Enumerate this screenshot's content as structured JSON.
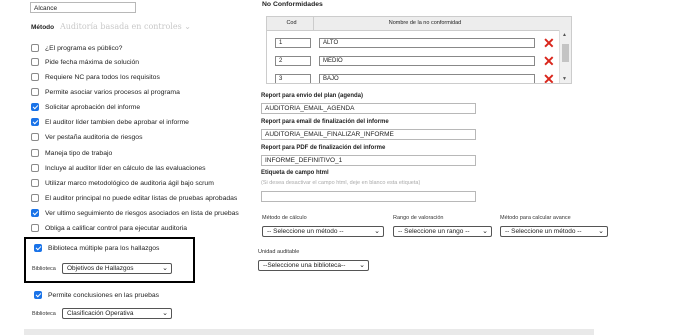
{
  "left": {
    "alcance_value": "Alcance",
    "metodo_label": "Método",
    "metodo_value": "Auditoría basada en controles",
    "checkboxes": [
      {
        "label": "¿El programa es público?",
        "checked": false
      },
      {
        "label": "Pide fecha máxima de solución",
        "checked": false
      },
      {
        "label": "Requiere NC para todos los requisitos",
        "checked": false
      },
      {
        "label": "Permite asociar varios procesos al programa",
        "checked": false
      },
      {
        "label": "Solicitar aprobación del informe",
        "checked": true
      },
      {
        "label": "El auditor líder tambien debe aprobar el informe",
        "checked": true
      },
      {
        "label": "Ver pestaña auditoria de riesgos",
        "checked": false
      },
      {
        "label": "Maneja tipo de trabajo",
        "checked": false
      },
      {
        "label": "Incluye al auditor líder en cálculo de las evaluaciones",
        "checked": false
      },
      {
        "label": "Utilizar marco metodológico de auditoria ágil bajo scrum",
        "checked": false
      },
      {
        "label": "El auditor principal no puede editar listas de pruebas aprobadas",
        "checked": false
      },
      {
        "label": "Ver ultimo seguimiento de riesgos asociados en lista de pruebas",
        "checked": true
      },
      {
        "label": "Obliga a calificar control para ejecutar auditoria",
        "checked": false
      }
    ],
    "biblioteca_multiple_label": "Biblioteca múltiple para los hallazgos",
    "biblioteca_label": "Biblioteca",
    "biblioteca_value": "Objetivos de Hallazgos",
    "conclusiones_label": "Permite conclusiones en las pruebas",
    "biblioteca2_label": "Biblioteca",
    "biblioteca2_value": "Clasificación Operativa"
  },
  "right": {
    "nc_title": "No Conformidades",
    "nc_headers": [
      "Cod",
      "Nombre de la no conformidad"
    ],
    "nc_rows": [
      {
        "cod": "1",
        "nombre": "ALTO"
      },
      {
        "cod": "2",
        "nombre": "MEDIO"
      },
      {
        "cod": "3",
        "nombre": "BAJO"
      }
    ],
    "envio_label": "Report para envio del plan (agenda)",
    "envio_value": "AUDITORIA_EMAIL_AGENDA",
    "finalizacion_label": "Report para email de finalización del informe",
    "finalizacion_value": "AUDITORIA_EMAIL_FINALIZAR_INFORME",
    "pdf_label": "Report para PDF de finalización del informe",
    "pdf_value": "INFORME_DEFINITIVO_1",
    "etiqueta_label": "Etiqueta de campo html",
    "etiqueta_hint": "(Si desea desactivar el campo html, deje en blanco esta etiqueta)",
    "etiqueta_value": "",
    "metodo_calculo_label": "Método de cálculo",
    "metodo_calculo_value": "-- Seleccione un método --",
    "rango_label": "Rango de valoración",
    "rango_value": "-- Seleccione un rango --",
    "avance_label": "Método para calcular avance",
    "avance_value": "-- Seleccione un método --",
    "unidad_label": "Unidad auditable",
    "unidad_value": "--Seleccione una biblioteca--"
  },
  "colors": {
    "accent": "#1a73e8",
    "delete": "#d9261c"
  },
  "icons": {
    "delete": "close-icon",
    "dropdown": "chevron-down-icon"
  }
}
